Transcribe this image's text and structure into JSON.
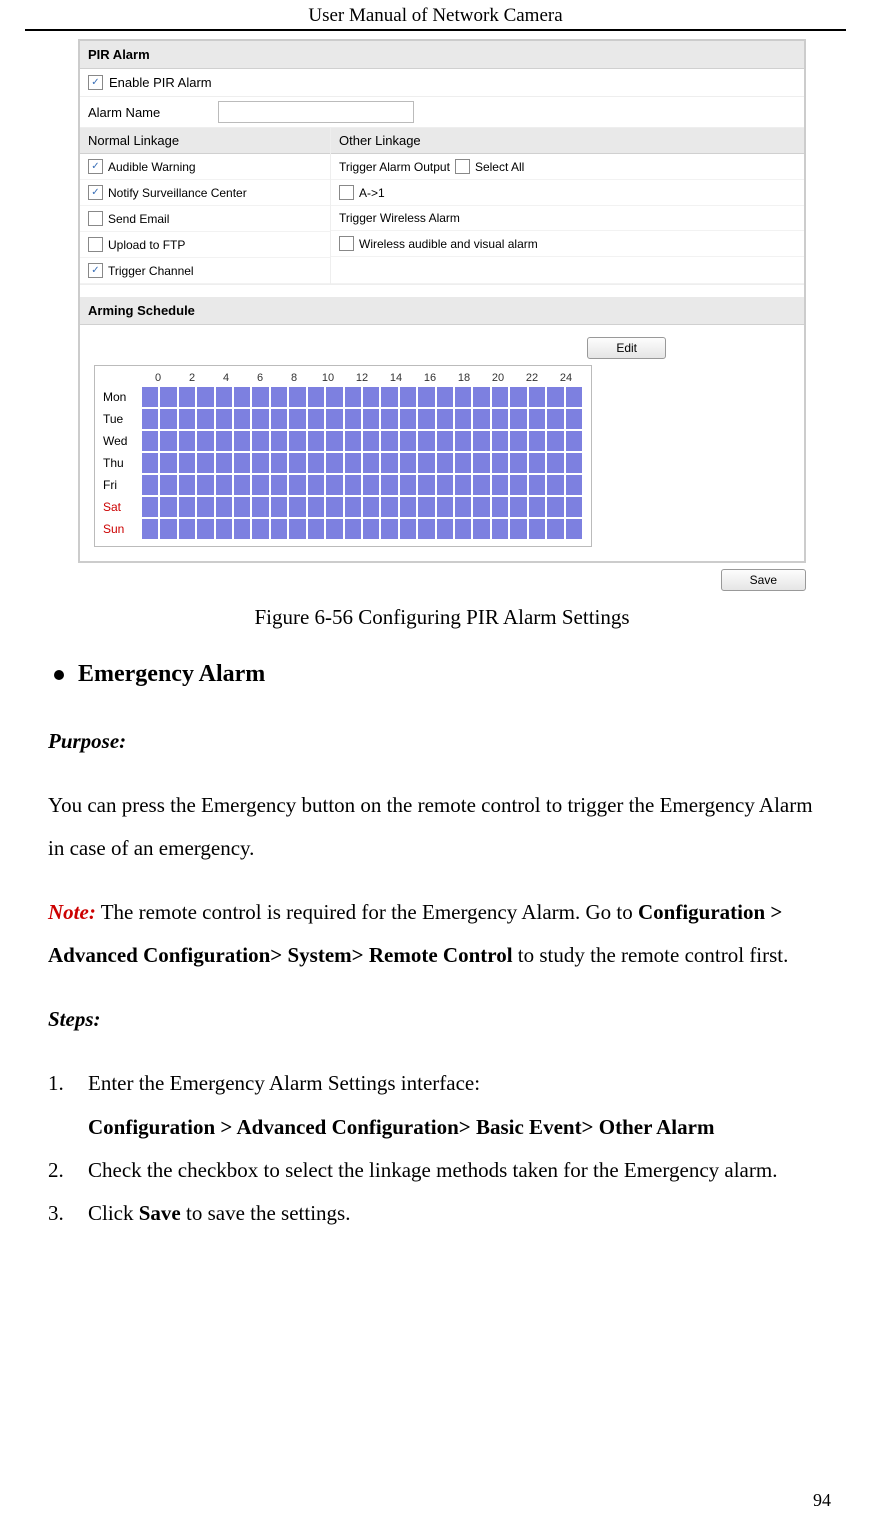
{
  "header": "User Manual of Network Camera",
  "page_number": "94",
  "figure": {
    "caption": "Figure 6-56 Configuring PIR Alarm Settings",
    "pir_alarm": {
      "title": "PIR Alarm",
      "enable_label": "Enable PIR Alarm",
      "enable_checked": true,
      "alarm_name_label": "Alarm Name",
      "alarm_name_value": "",
      "normal_linkage_hdr": "Normal Linkage",
      "other_linkage_hdr": "Other Linkage",
      "normal_linkage": [
        {
          "label": "Audible Warning",
          "checked": true
        },
        {
          "label": "Notify Surveillance Center",
          "checked": true
        },
        {
          "label": "Send Email",
          "checked": false
        },
        {
          "label": "Upload to FTP",
          "checked": false
        },
        {
          "label": "Trigger Channel",
          "checked": true
        }
      ],
      "other_linkage": {
        "trigger_output_label": "Trigger Alarm Output",
        "select_all_label": "Select All",
        "select_all_checked": false,
        "a1_label": "A->1",
        "a1_checked": false,
        "trigger_wireless_label": "Trigger Wireless Alarm",
        "wireless_av_label": "Wireless audible and visual alarm",
        "wireless_av_checked": false
      }
    },
    "arming_schedule": {
      "title": "Arming Schedule",
      "edit_label": "Edit",
      "save_label": "Save",
      "hours": [
        "0",
        "2",
        "4",
        "6",
        "8",
        "10",
        "12",
        "14",
        "16",
        "18",
        "20",
        "22",
        "24"
      ],
      "days": [
        {
          "label": "Mon",
          "weekend": false
        },
        {
          "label": "Tue",
          "weekend": false
        },
        {
          "label": "Wed",
          "weekend": false
        },
        {
          "label": "Thu",
          "weekend": false
        },
        {
          "label": "Fri",
          "weekend": false
        },
        {
          "label": "Sat",
          "weekend": true
        },
        {
          "label": "Sun",
          "weekend": true
        }
      ]
    }
  },
  "body": {
    "bullet_heading": "Emergency Alarm",
    "purpose_label": "Purpose:",
    "purpose_text": "You can press the Emergency button on the remote control to trigger the Emergency Alarm in case of an emergency.",
    "note_label": "Note:",
    "note_part1": " The remote control is required for the Emergency Alarm. Go to ",
    "note_bold": "Configuration > Advanced Configuration> System> Remote Control",
    "note_part2": " to study the remote control first.",
    "steps_label": "Steps:",
    "steps": [
      {
        "text": "Enter the Emergency Alarm Settings interface:",
        "path": "Configuration > Advanced Configuration> Basic Event> Other Alarm"
      },
      {
        "text": "Check the checkbox to select the linkage methods taken for the Emergency alarm."
      },
      {
        "text_pre": "Click ",
        "bold": "Save",
        "text_post": " to save the settings."
      }
    ]
  }
}
